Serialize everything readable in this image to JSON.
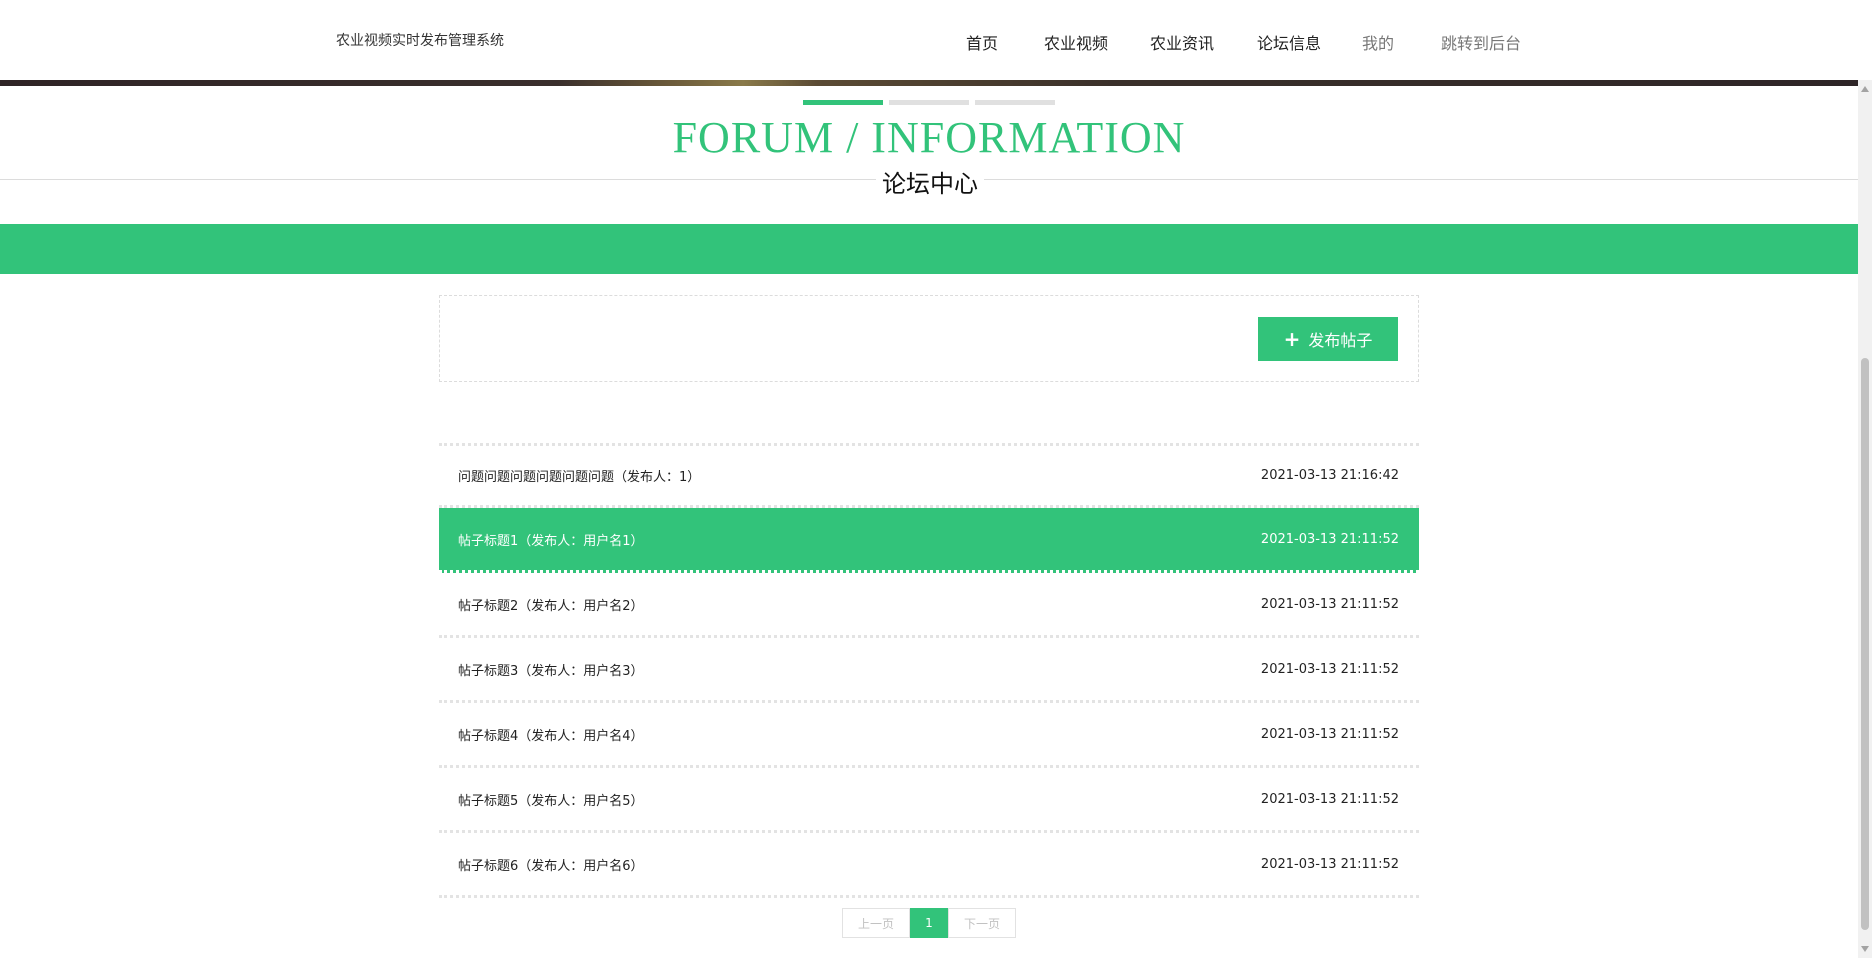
{
  "header": {
    "site_title": "农业视频实时发布管理系统",
    "nav": [
      {
        "label": "首页",
        "muted": false
      },
      {
        "label": "农业视频",
        "muted": false
      },
      {
        "label": "农业资讯",
        "muted": false
      },
      {
        "label": "论坛信息",
        "muted": false
      },
      {
        "label": "我的",
        "muted": true
      },
      {
        "label": "跳转到后台",
        "muted": true
      }
    ]
  },
  "section": {
    "title_en": "FORUM / INFORMATION",
    "title_cn": "论坛中心"
  },
  "actions": {
    "publish_label": "发布帖子",
    "publish_icon": "plus-icon"
  },
  "posts": [
    {
      "title": "问题问题问题问题问题问题（发布人：1）",
      "time": "2021-03-13 21:16:42",
      "highlight": false
    },
    {
      "title": "帖子标题1（发布人：用户名1）",
      "time": "2021-03-13 21:11:52",
      "highlight": true
    },
    {
      "title": "帖子标题2（发布人：用户名2）",
      "time": "2021-03-13 21:11:52",
      "highlight": false
    },
    {
      "title": "帖子标题3（发布人：用户名3）",
      "time": "2021-03-13 21:11:52",
      "highlight": false
    },
    {
      "title": "帖子标题4（发布人：用户名4）",
      "time": "2021-03-13 21:11:52",
      "highlight": false
    },
    {
      "title": "帖子标题5（发布人：用户名5）",
      "time": "2021-03-13 21:11:52",
      "highlight": false
    },
    {
      "title": "帖子标题6（发布人：用户名6）",
      "time": "2021-03-13 21:11:52",
      "highlight": false
    }
  ],
  "pagination": {
    "prev_label": "上一页",
    "current_page": "1",
    "next_label": "下一页"
  },
  "colors": {
    "accent": "#32c37a"
  }
}
